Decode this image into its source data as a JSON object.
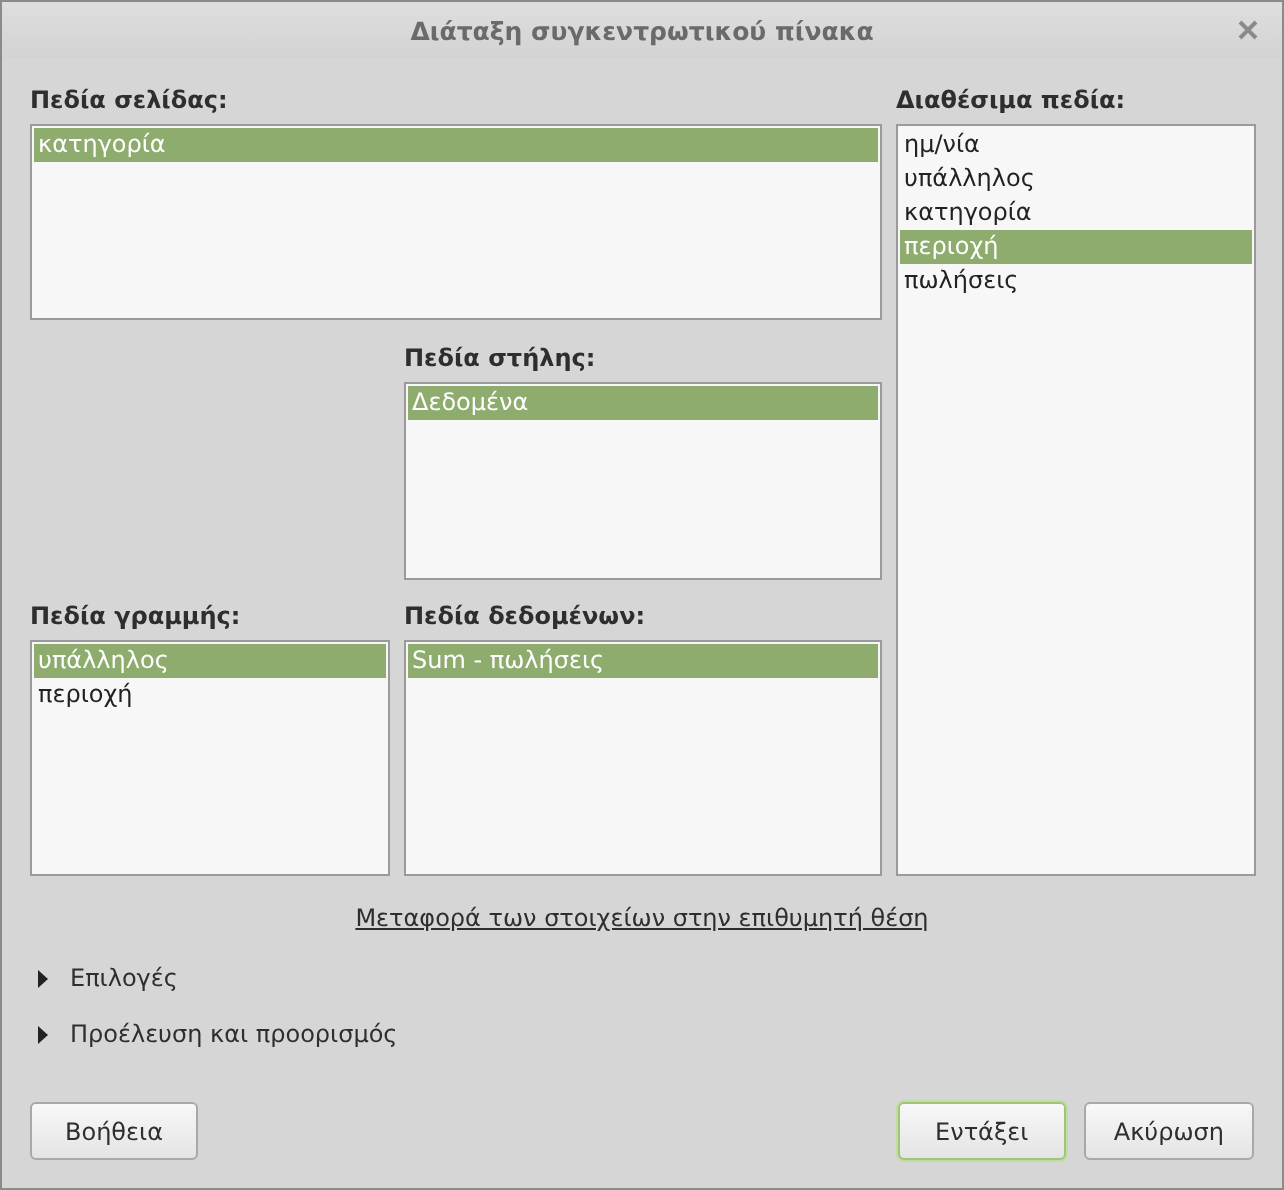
{
  "window": {
    "title": "Διάταξη συγκεντρωτικού πίνακα"
  },
  "page_fields": {
    "label": "Πεδία σελίδας:",
    "items": [
      {
        "label": "κατηγορία",
        "selected": true
      }
    ]
  },
  "column_fields": {
    "label": "Πεδία στήλης:",
    "items": [
      {
        "label": "Δεδομένα",
        "selected": true
      }
    ]
  },
  "row_fields": {
    "label": "Πεδία γραμμής:",
    "items": [
      {
        "label": "υπάλληλος",
        "selected": true
      },
      {
        "label": "περιοχή",
        "selected": false
      }
    ]
  },
  "data_fields": {
    "label": "Πεδία δεδομένων:",
    "items": [
      {
        "label": "Sum - πωλήσεις",
        "selected": true
      }
    ]
  },
  "available_fields": {
    "label": "Διαθέσιμα πεδία:",
    "items": [
      {
        "label": "ημ/νία",
        "selected": false
      },
      {
        "label": "υπάλληλος",
        "selected": false
      },
      {
        "label": "κατηγορία",
        "selected": false
      },
      {
        "label": "περιοχή",
        "selected": true
      },
      {
        "label": "πωλήσεις",
        "selected": false
      }
    ]
  },
  "hint_link": "Μεταφορά των στοιχείων στην επιθυμητή θέση",
  "expanders": [
    {
      "label": "Επιλογές",
      "expanded": false
    },
    {
      "label": "Προέλευση και προορισμός",
      "expanded": false
    }
  ],
  "left_buttons": [
    {
      "label": "Βοήθεια",
      "focused": false
    }
  ],
  "right_buttons": [
    {
      "label": "Εντάξει",
      "focused": true
    },
    {
      "label": "Ακύρωση",
      "focused": false
    }
  ]
}
